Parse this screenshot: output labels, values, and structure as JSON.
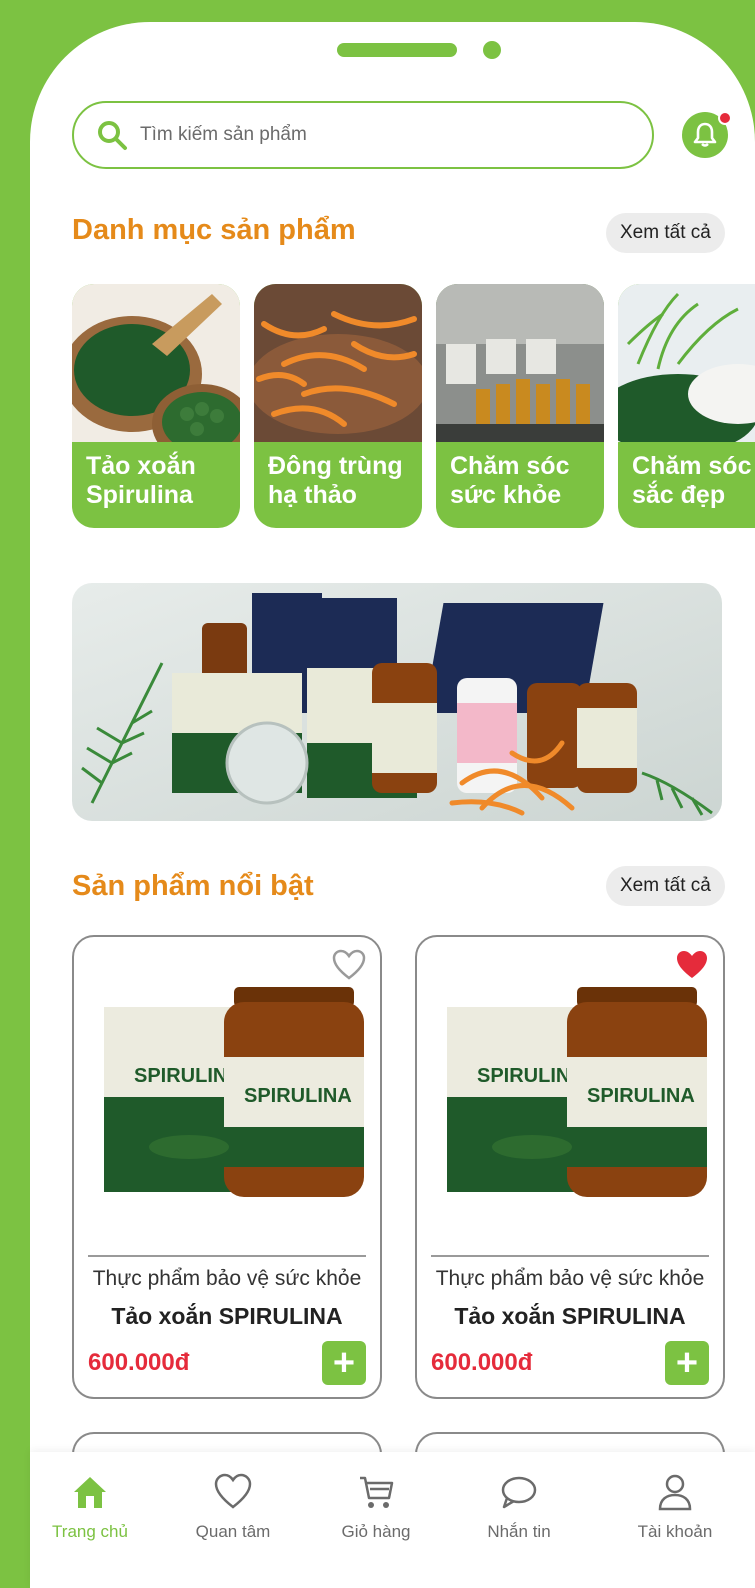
{
  "colors": {
    "brand_green": "#7cc242",
    "accent_orange": "#e58a1a",
    "price_red": "#e52b3b"
  },
  "search": {
    "placeholder": "Tìm kiếm sản phẩm",
    "icon": "search-icon"
  },
  "notification": {
    "icon": "bell-icon",
    "has_unread": true
  },
  "categories_section": {
    "title": "Danh mục sản phẩm",
    "see_all": "Xem tất cả",
    "items": [
      {
        "label": "Tảo xoắn\nSpirulina"
      },
      {
        "label": "Đông trùng\nhạ thảo"
      },
      {
        "label": "Chăm sóc\nsức khỏe"
      },
      {
        "label": "Chăm sóc\nsắc đẹp"
      }
    ]
  },
  "featured_section": {
    "title": "Sản phẩm nổi bật",
    "see_all": "Xem tất cả",
    "products": [
      {
        "subtitle": "Thực phẩm bảo vệ sức khỏe",
        "name": "Tảo xoắn SPIRULINA",
        "price": "600.000đ",
        "favorited": false
      },
      {
        "subtitle": "Thực phẩm bảo vệ sức khỏe",
        "name": "Tảo xoắn SPIRULINA",
        "price": "600.000đ",
        "favorited": true
      }
    ]
  },
  "bottom_nav": {
    "items": [
      {
        "label": "Trang chủ",
        "icon": "home-icon",
        "active": true
      },
      {
        "label": "Quan tâm",
        "icon": "heart-icon",
        "active": false
      },
      {
        "label": "Giỏ hàng",
        "icon": "cart-icon",
        "active": false
      },
      {
        "label": "Nhắn tin",
        "icon": "chat-icon",
        "active": false
      },
      {
        "label": "Tài khoản",
        "icon": "user-icon",
        "active": false
      }
    ]
  }
}
